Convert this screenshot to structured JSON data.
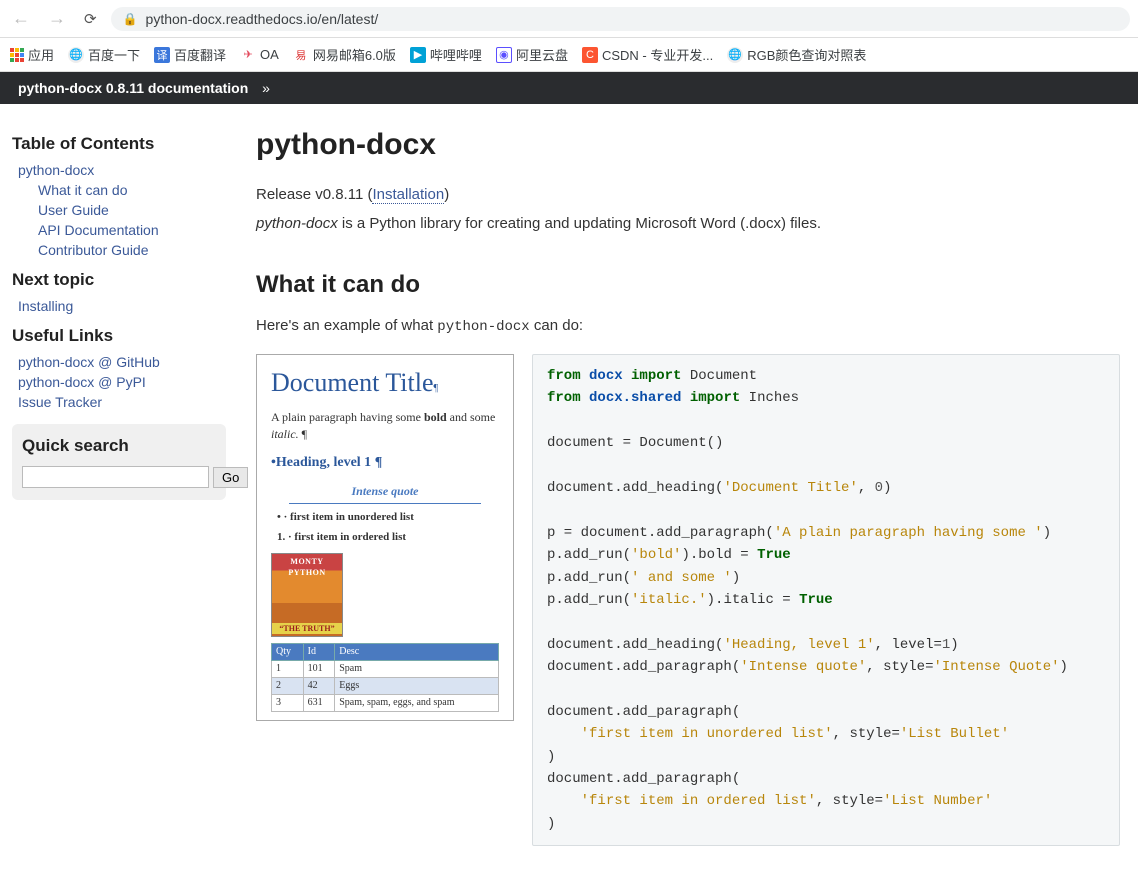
{
  "browser": {
    "url": "python-docx.readthedocs.io/en/latest/",
    "bookmarks": [
      {
        "label": "应用"
      },
      {
        "label": "百度一下"
      },
      {
        "label": "百度翻译"
      },
      {
        "label": "OA"
      },
      {
        "label": "网易邮箱6.0版"
      },
      {
        "label": "哔哩哔哩"
      },
      {
        "label": "阿里云盘"
      },
      {
        "label": "CSDN - 专业开发..."
      },
      {
        "label": "RGB颜色查询对照表"
      }
    ]
  },
  "doc_strip": {
    "title": "python-docx 0.8.11 documentation",
    "sep": "»"
  },
  "sidebar": {
    "toc_heading": "Table of Contents",
    "toc": {
      "root": "python-docx",
      "children": [
        "What it can do",
        "User Guide",
        "API Documentation",
        "Contributor Guide"
      ]
    },
    "next_heading": "Next topic",
    "next_item": "Installing",
    "links_heading": "Useful Links",
    "links": [
      "python-docx @ GitHub",
      "python-docx @ PyPI",
      "Issue Tracker"
    ],
    "quicksearch": {
      "title": "Quick search",
      "button": "Go",
      "placeholder": ""
    }
  },
  "content": {
    "title": "python-docx",
    "release_prefix": "Release v0.8.11 (",
    "install_link": "Installation",
    "release_suffix": ")",
    "intro_em": "python-docx",
    "intro_rest": " is a Python library for creating and updating Microsoft Word (.docx) files.",
    "section_heading": "What it can do",
    "example_prefix": "Here's an example of what ",
    "example_code": "python-docx",
    "example_suffix": " can do:"
  },
  "doc_preview": {
    "title": "Document Title",
    "paragraph_pre": "A plain paragraph having some ",
    "bold": "bold",
    "mid": " and some ",
    "italic": "italic.",
    "heading": "Heading, level 1",
    "quote": "Intense quote",
    "ul_item": "first item in unordered list",
    "ol_item": "1. · first item in ordered list",
    "pic_top": "MONTY PYTHON",
    "pic_bottom": "“THE TRUTH”",
    "table": {
      "headers": [
        "Qty",
        "Id",
        "Desc"
      ],
      "rows": [
        [
          "1",
          "101",
          "Spam"
        ],
        [
          "2",
          "42",
          "Eggs"
        ],
        [
          "3",
          "631",
          "Spam, spam, eggs, and spam"
        ]
      ]
    }
  },
  "code": {
    "l1_from": "from",
    "l1_mod": "docx",
    "l1_import": "import",
    "l1_name": "Document",
    "l2_from": "from",
    "l2_mod": "docx.shared",
    "l2_import": "import",
    "l2_name": "Inches",
    "l3": "document = Document()",
    "l4_pre": "document.add_heading(",
    "l4_str": "'Document Title'",
    "l4_num": "0",
    "l4_suf": ")",
    "l5_pre": "p = document.add_paragraph(",
    "l5_str": "'A plain paragraph having some '",
    "l5_suf": ")",
    "l6_pre": "p.add_run(",
    "l6_str": "'bold'",
    "l6_mid": ").bold = ",
    "l6_true": "True",
    "l7_pre": "p.add_run(",
    "l7_str": "' and some '",
    "l7_suf": ")",
    "l8_pre": "p.add_run(",
    "l8_str": "'italic.'",
    "l8_mid": ").italic = ",
    "l8_true": "True",
    "l9_pre": "document.add_heading(",
    "l9_str": "'Heading, level 1'",
    "l9_mid": ", level=",
    "l9_num": "1",
    "l9_suf": ")",
    "l10_pre": "document.add_paragraph(",
    "l10_str": "'Intense quote'",
    "l10_mid": ", style=",
    "l10_str2": "'Intense Quote'",
    "l10_suf": ")",
    "l11": "document.add_paragraph(",
    "l12_str": "'first item in unordered list'",
    "l12_mid": ", style=",
    "l12_str2": "'List Bullet'",
    "l13": ")",
    "l14": "document.add_paragraph(",
    "l15_str": "'first item in ordered list'",
    "l15_mid": ", style=",
    "l15_str2": "'List Number'",
    "l16": ")"
  }
}
